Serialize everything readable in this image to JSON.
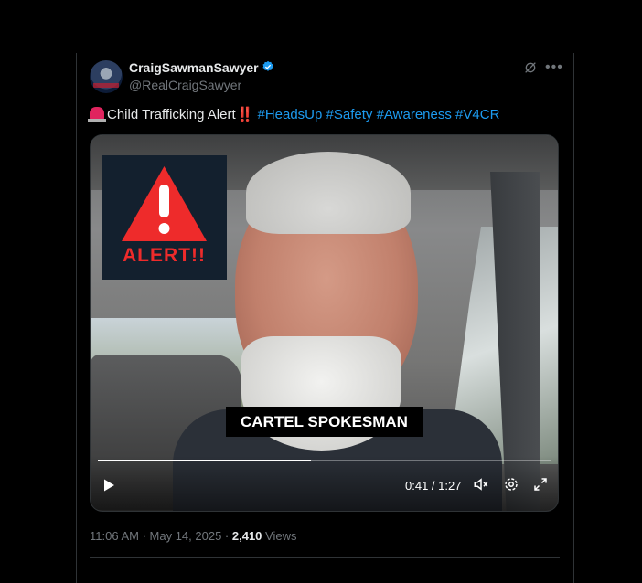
{
  "author": {
    "display_name": "CraigSawmanSawyer",
    "handle": "@RealCraigSawyer"
  },
  "tweet": {
    "text_main": "Child Trafficking Alert",
    "bangs": "‼️",
    "hashtags": [
      "#HeadsUp",
      "#Safety",
      "#Awareness",
      "#V4CR"
    ]
  },
  "video": {
    "overlay_alert": "ALERT!!",
    "caption": "CARTEL SPOKESMAN",
    "current_time": "0:41",
    "separator": " / ",
    "duration": "1:27",
    "progress": 0.47
  },
  "meta": {
    "time": "11:06 AM",
    "dot": " · ",
    "date": "May 14, 2025",
    "views_count": "2,410",
    "views_label": " Views"
  },
  "colors": {
    "accent": "#1d9bf0",
    "background": "#000000",
    "alert_red": "#ee2b2b"
  },
  "icons": [
    "verified-badge-icon",
    "grok-icon",
    "more-icon",
    "siren-icon",
    "play-icon",
    "mute-icon",
    "settings-icon",
    "fullscreen-icon"
  ]
}
